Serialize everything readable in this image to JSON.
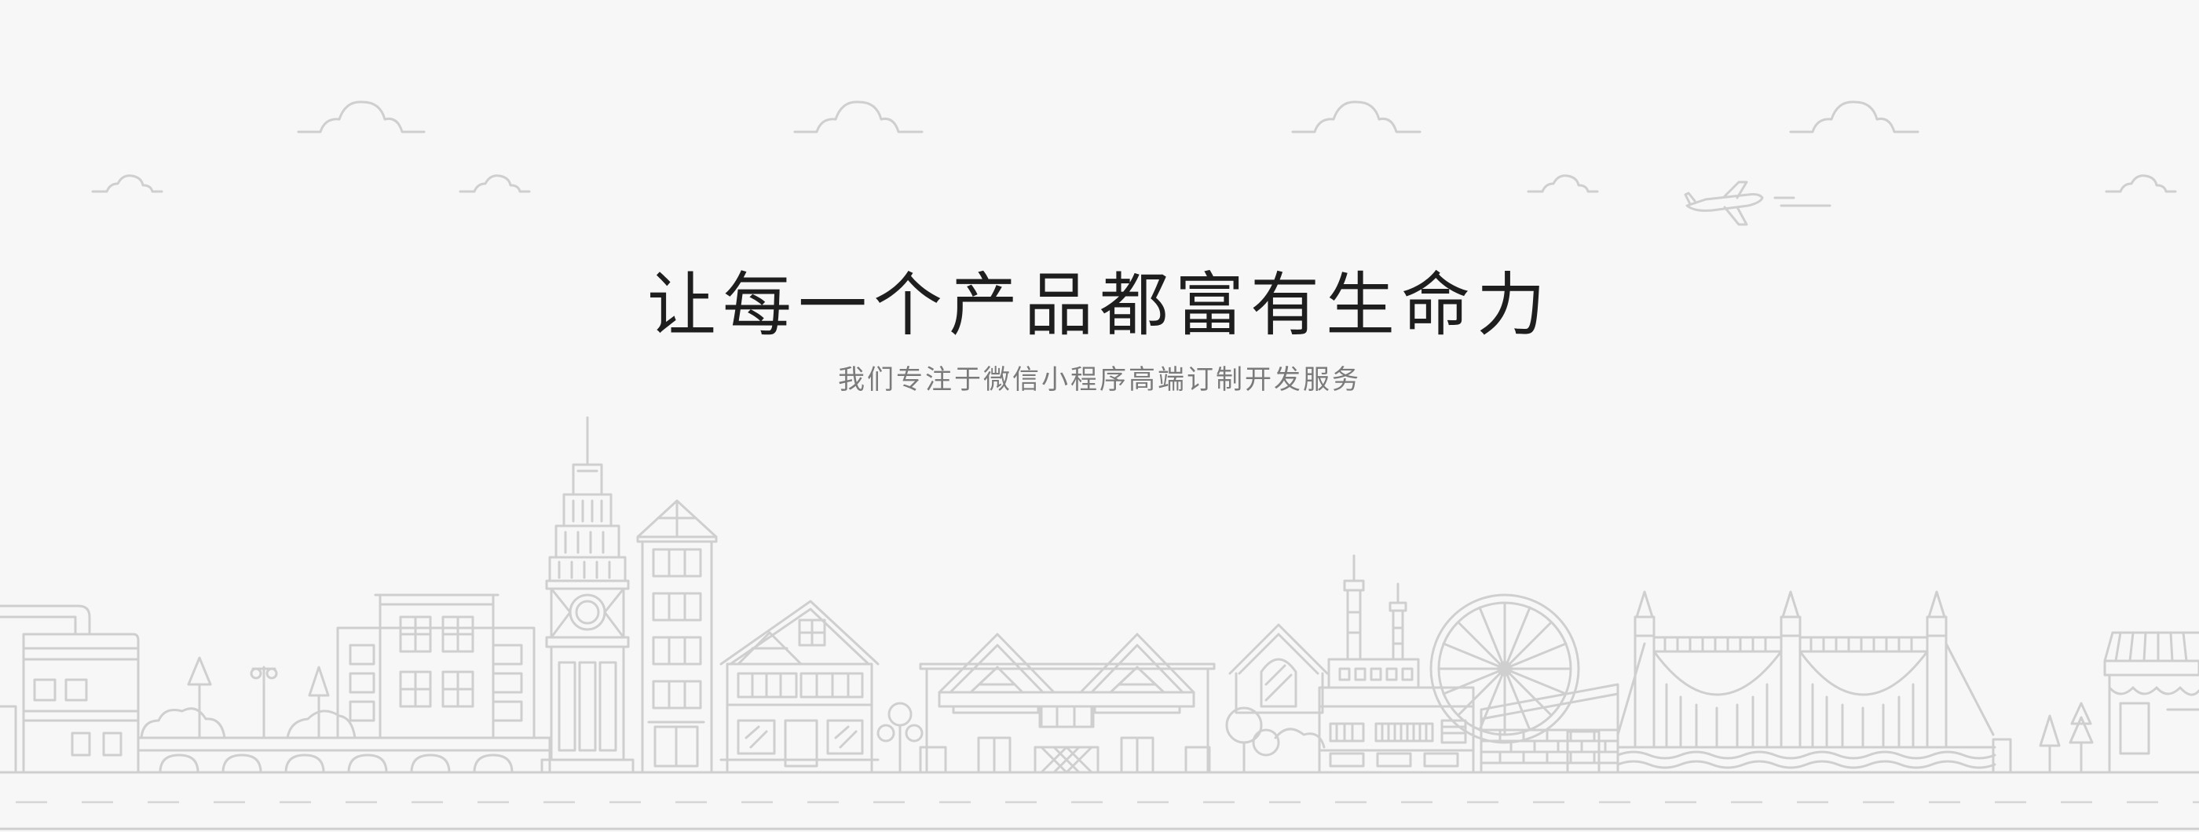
{
  "hero": {
    "title": "让每一个产品都富有生命力",
    "subtitle": "我们专注于微信小程序高端订制开发服务"
  },
  "illustration": {
    "style": "line-art cityscape",
    "stroke_color": "#cfcfcf",
    "background_color": "#f7f7f7"
  }
}
